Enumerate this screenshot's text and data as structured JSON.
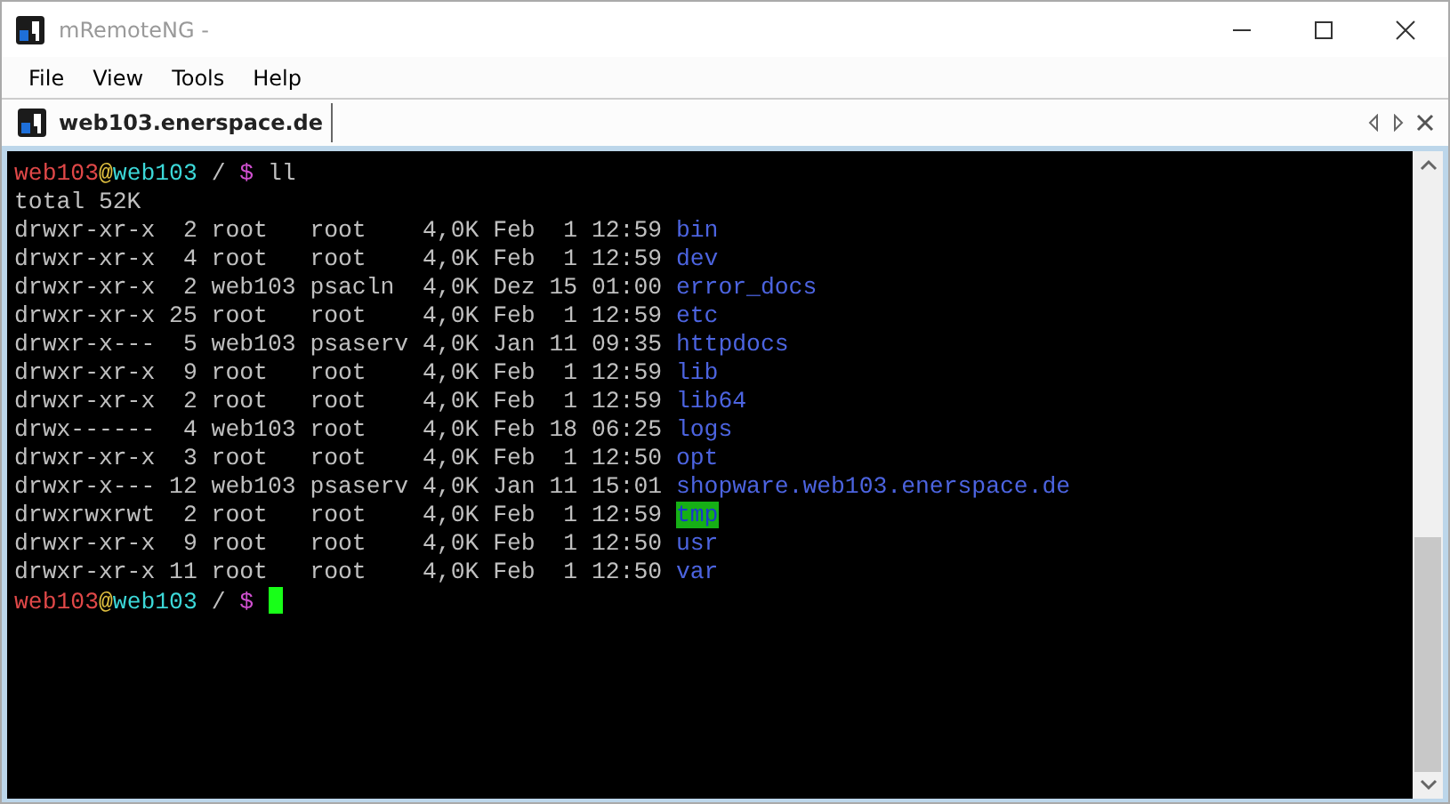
{
  "window": {
    "title": "mRemoteNG -"
  },
  "menu": [
    "File",
    "View",
    "Tools",
    "Help"
  ],
  "tabs": [
    {
      "label": "web103.enerspace.de",
      "selected": true
    }
  ],
  "terminal": {
    "lines": [
      {
        "kind": "prompt",
        "user": "web103",
        "at": "@",
        "host": "web103",
        "path": "/",
        "sign": "$",
        "command": "ll",
        "cursor": false
      },
      {
        "kind": "text",
        "text": "total 52K"
      },
      {
        "kind": "dir",
        "info": "drwxr-xr-x  2 root   root    4,0K Feb  1 12:59",
        "name": "bin"
      },
      {
        "kind": "dir",
        "info": "drwxr-xr-x  4 root   root    4,0K Feb  1 12:59",
        "name": "dev"
      },
      {
        "kind": "dir",
        "info": "drwxr-xr-x  2 web103 psacln  4,0K Dez 15 01:00",
        "name": "error_docs"
      },
      {
        "kind": "dir",
        "info": "drwxr-xr-x 25 root   root    4,0K Feb  1 12:59",
        "name": "etc"
      },
      {
        "kind": "dir",
        "info": "drwxr-x---  5 web103 psaserv 4,0K Jan 11 09:35",
        "name": "httpdocs"
      },
      {
        "kind": "dir",
        "info": "drwxr-xr-x  9 root   root    4,0K Feb  1 12:59",
        "name": "lib"
      },
      {
        "kind": "dir",
        "info": "drwxr-xr-x  2 root   root    4,0K Feb  1 12:59",
        "name": "lib64"
      },
      {
        "kind": "dir",
        "info": "drwx------  4 web103 root    4,0K Feb 18 06:25",
        "name": "logs"
      },
      {
        "kind": "dir",
        "info": "drwxr-xr-x  3 root   root    4,0K Feb  1 12:50",
        "name": "opt"
      },
      {
        "kind": "dir",
        "info": "drwxr-x--- 12 web103 psaserv 4,0K Jan 11 15:01",
        "name": "shopware.web103.enerspace.de"
      },
      {
        "kind": "sticky",
        "info": "drwxrwxrwt  2 root   root    4,0K Feb  1 12:59",
        "name": "tmp"
      },
      {
        "kind": "dir",
        "info": "drwxr-xr-x  9 root   root    4,0K Feb  1 12:50",
        "name": "usr"
      },
      {
        "kind": "dir",
        "info": "drwxr-xr-x 11 root   root    4,0K Feb  1 12:50",
        "name": "var"
      },
      {
        "kind": "prompt",
        "user": "web103",
        "at": "@",
        "host": "web103",
        "path": "/",
        "sign": "$",
        "cursor": true
      }
    ]
  }
}
